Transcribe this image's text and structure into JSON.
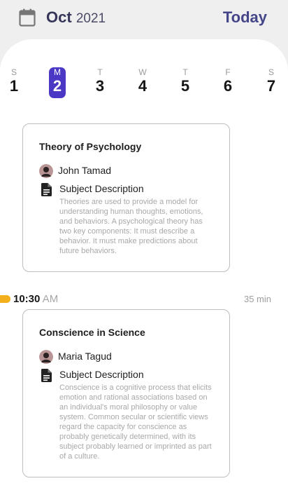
{
  "header": {
    "month": "Oct",
    "year": "2021",
    "today_label": "Today"
  },
  "week": {
    "selected_index": 1,
    "days": [
      {
        "weekday": "S",
        "date": "1"
      },
      {
        "weekday": "M",
        "date": "2"
      },
      {
        "weekday": "T",
        "date": "3"
      },
      {
        "weekday": "W",
        "date": "4"
      },
      {
        "weekday": "T",
        "date": "5"
      },
      {
        "weekday": "F",
        "date": "6"
      },
      {
        "weekday": "S",
        "date": "7"
      }
    ]
  },
  "events": [
    {
      "title": "Theory of Psychology",
      "person": "John Tamad",
      "section_label": "Subject Description",
      "description": "Theories are used to provide a model for understanding human thoughts, emotions, and behaviors. A psychological theory has two key components: It must describe a behavior. It must make predictions about future behaviors."
    },
    {
      "time": "10:30",
      "meridiem": "AM",
      "duration": "35 min",
      "title": "Conscience in Science",
      "person": "Maria Tagud",
      "section_label": "Subject Description",
      "description": "Conscience is a cognitive process that elicits emotion and rational associations based on an individual's moral philosophy or value system. Common secular or scientific views regard the capacity for conscience as probably genetically determined, with its subject probably learned or imprinted as part of a culture."
    }
  ],
  "colors": {
    "accent": "#4b39c6",
    "time_marker": "#f4b01c",
    "header_text": "#45458a"
  },
  "icons": {
    "calendar": "calendar-icon",
    "person": "avatar",
    "document": "document-icon"
  }
}
